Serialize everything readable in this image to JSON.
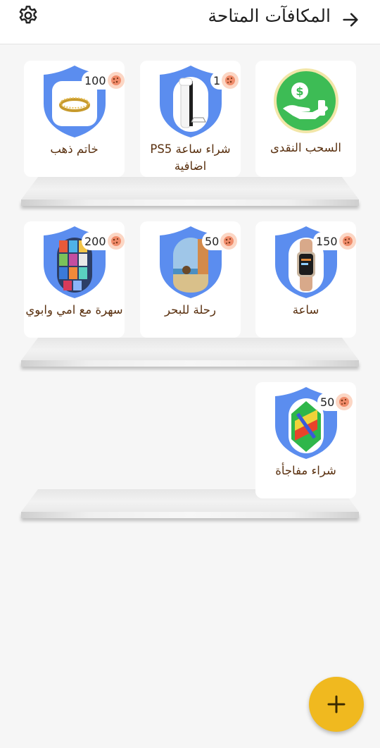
{
  "header": {
    "title": "المكافآت المتاحة",
    "back_icon": "arrow-right-icon",
    "settings_icon": "gear-icon"
  },
  "colors": {
    "shield": "#5b8def",
    "label": "#5a3110",
    "badge_cookie": "#fcd6c4",
    "fab": "#f0b91f",
    "cash_circle": "#3dbc55"
  },
  "rewards": [
    {
      "label": "السحب النقدى",
      "price": "",
      "image": "cash-hand-icon"
    },
    {
      "label": "شراء ساعة PS5 اضافية",
      "price": "1",
      "image": "ps5-console"
    },
    {
      "label": "خاتم ذهب",
      "price": "100",
      "image": "gold-ring"
    },
    {
      "label": "ساعة",
      "price": "150",
      "image": "smart-watch"
    },
    {
      "label": "رحلة للبحر",
      "price": "50",
      "image": "beach-photo"
    },
    {
      "label": "سهرة مع امي وابوي",
      "price": "200",
      "image": "movie-posters"
    },
    {
      "label": "شراء مفاجأة",
      "price": "50",
      "image": "surprise-text"
    }
  ],
  "fab": {
    "label": "+",
    "icon": "plus-icon"
  }
}
